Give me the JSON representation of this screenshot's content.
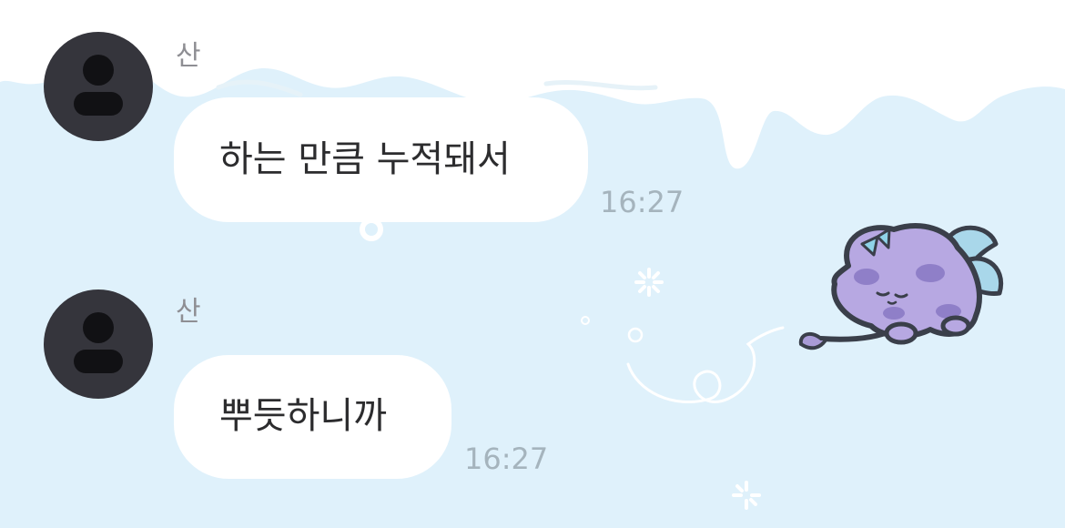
{
  "chat": {
    "messages": [
      {
        "sender": "산",
        "text": "하는 만큼 누적돼서",
        "time": "16:27"
      },
      {
        "sender": "산",
        "text": "뿌듯하니까",
        "time": "16:27"
      }
    ]
  },
  "avatar_icon": "person-silhouette-icon",
  "sticker": "sleeping-purple-creature-sticker",
  "colors": {
    "background": "#dff1fb",
    "bubble": "#ffffff",
    "avatar": "#35353c",
    "sender_name": "#8e8e93",
    "timestamp": "#a5b4bd",
    "message_text": "#2c2c2e"
  }
}
